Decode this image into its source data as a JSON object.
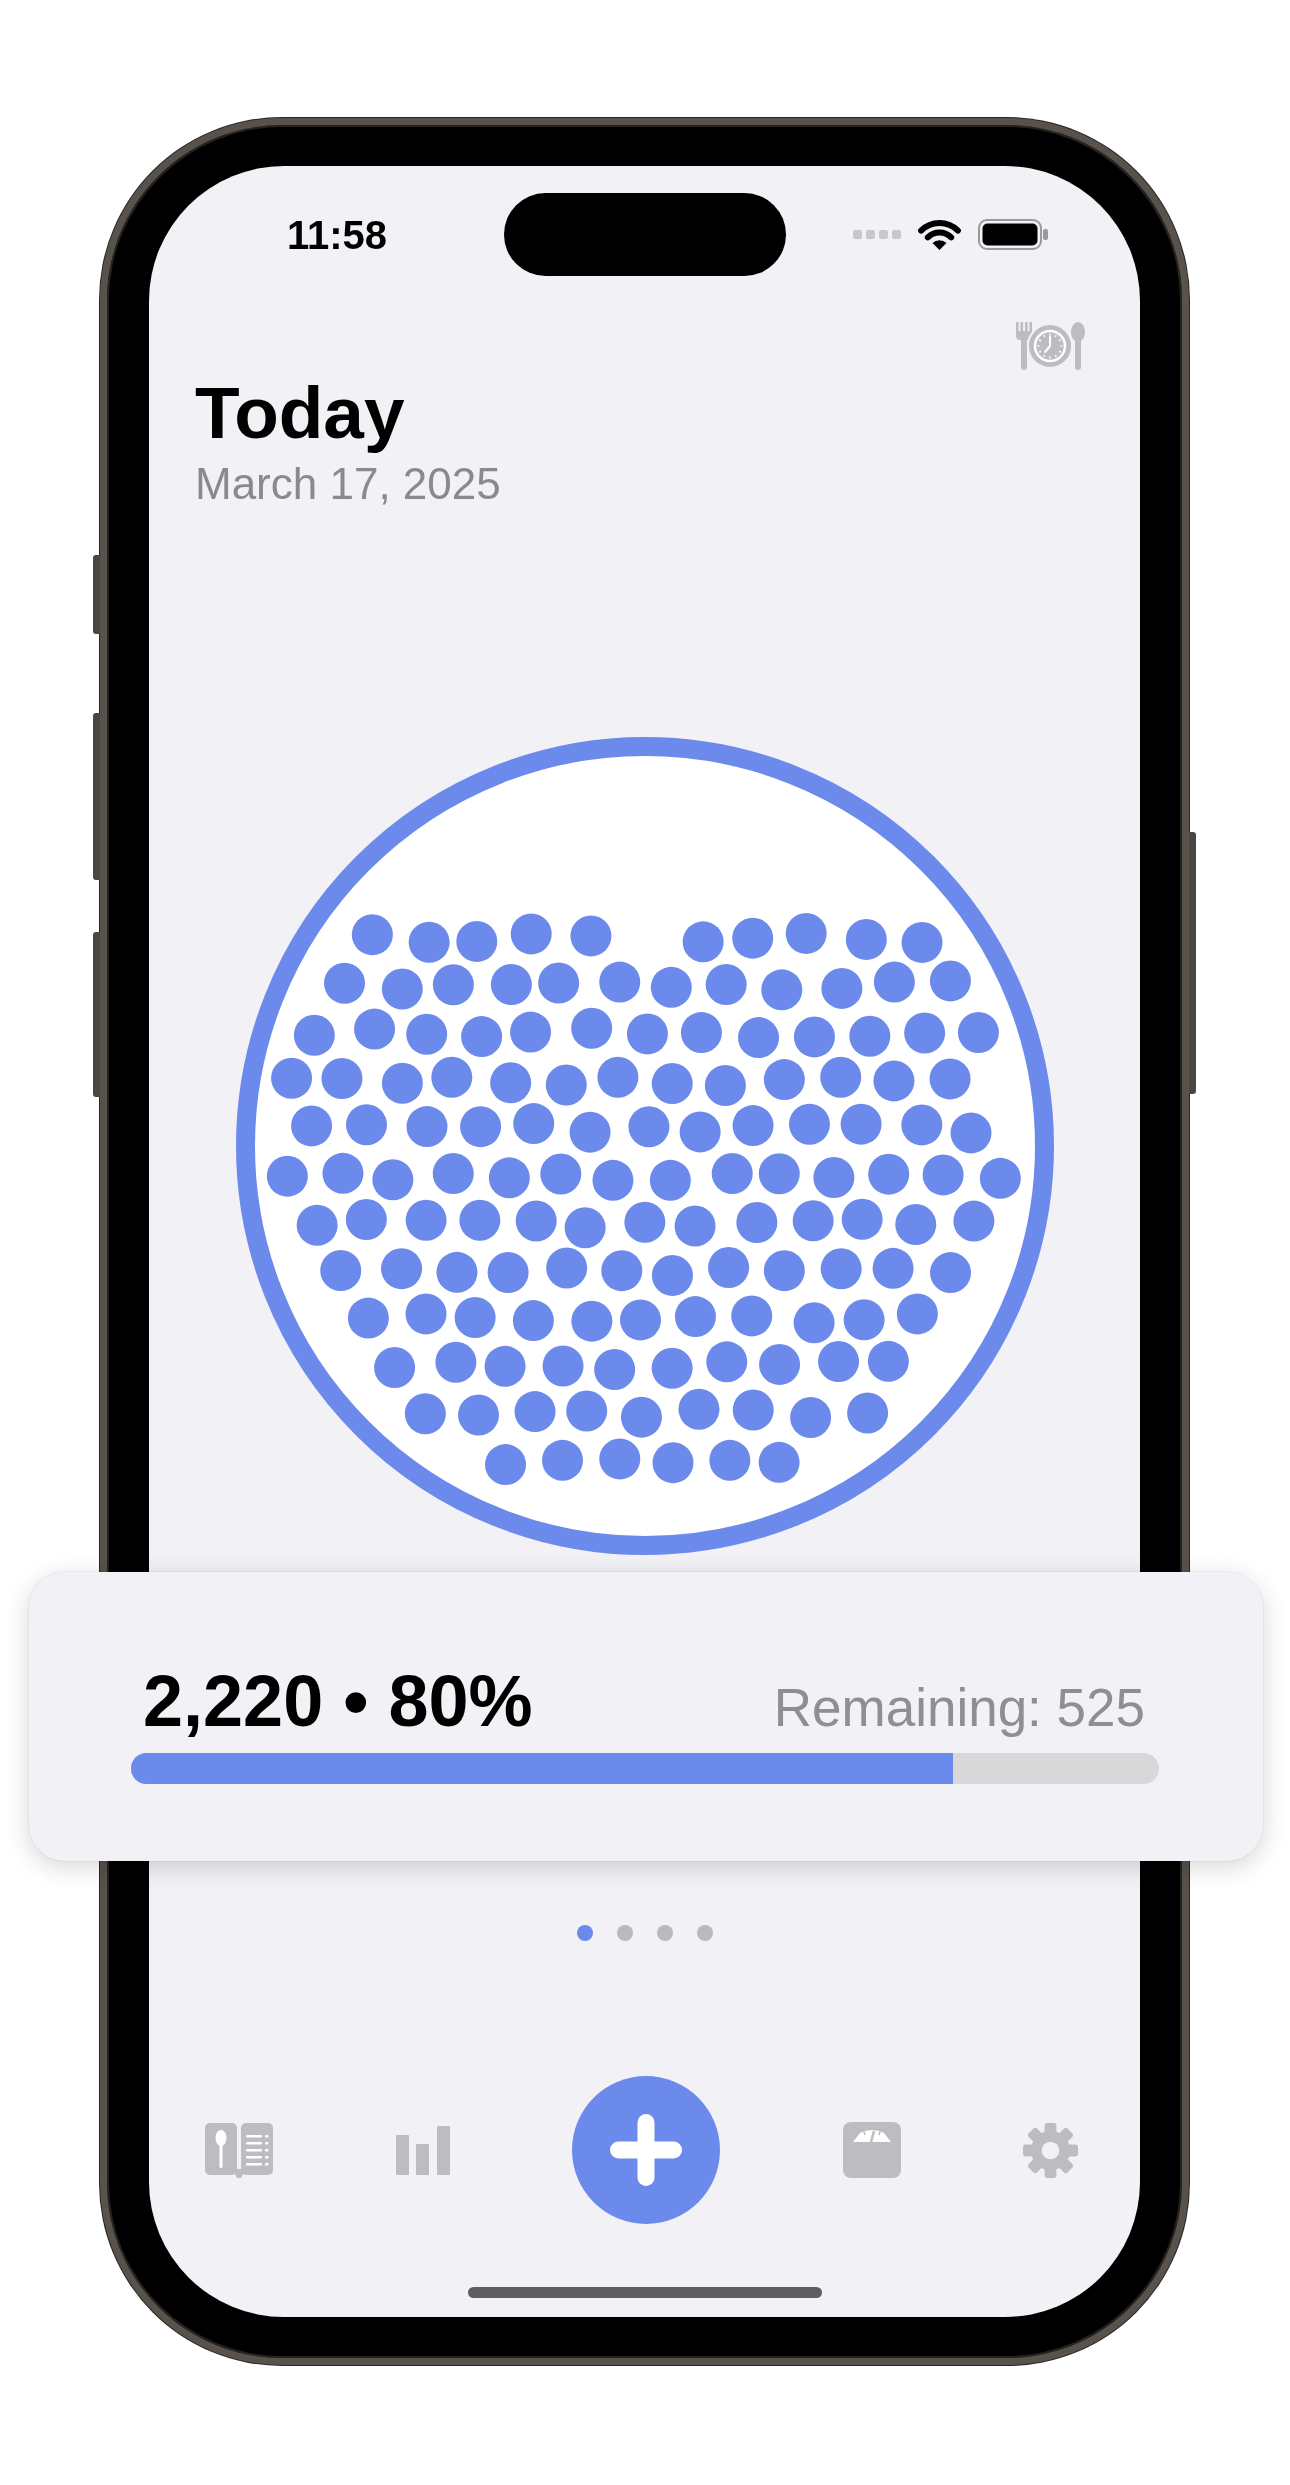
{
  "status_bar": {
    "time": "11:58"
  },
  "header": {
    "title": "Today",
    "date": "March 17, 2025"
  },
  "summary_card": {
    "total": "2,220 • 80%",
    "remaining": "Remaining: 525",
    "level": 0.8
  },
  "page_indicator": [
    {
      "selected": true
    },
    {
      "selected": false
    },
    {
      "selected": false
    },
    {
      "selected": false
    }
  ]
}
